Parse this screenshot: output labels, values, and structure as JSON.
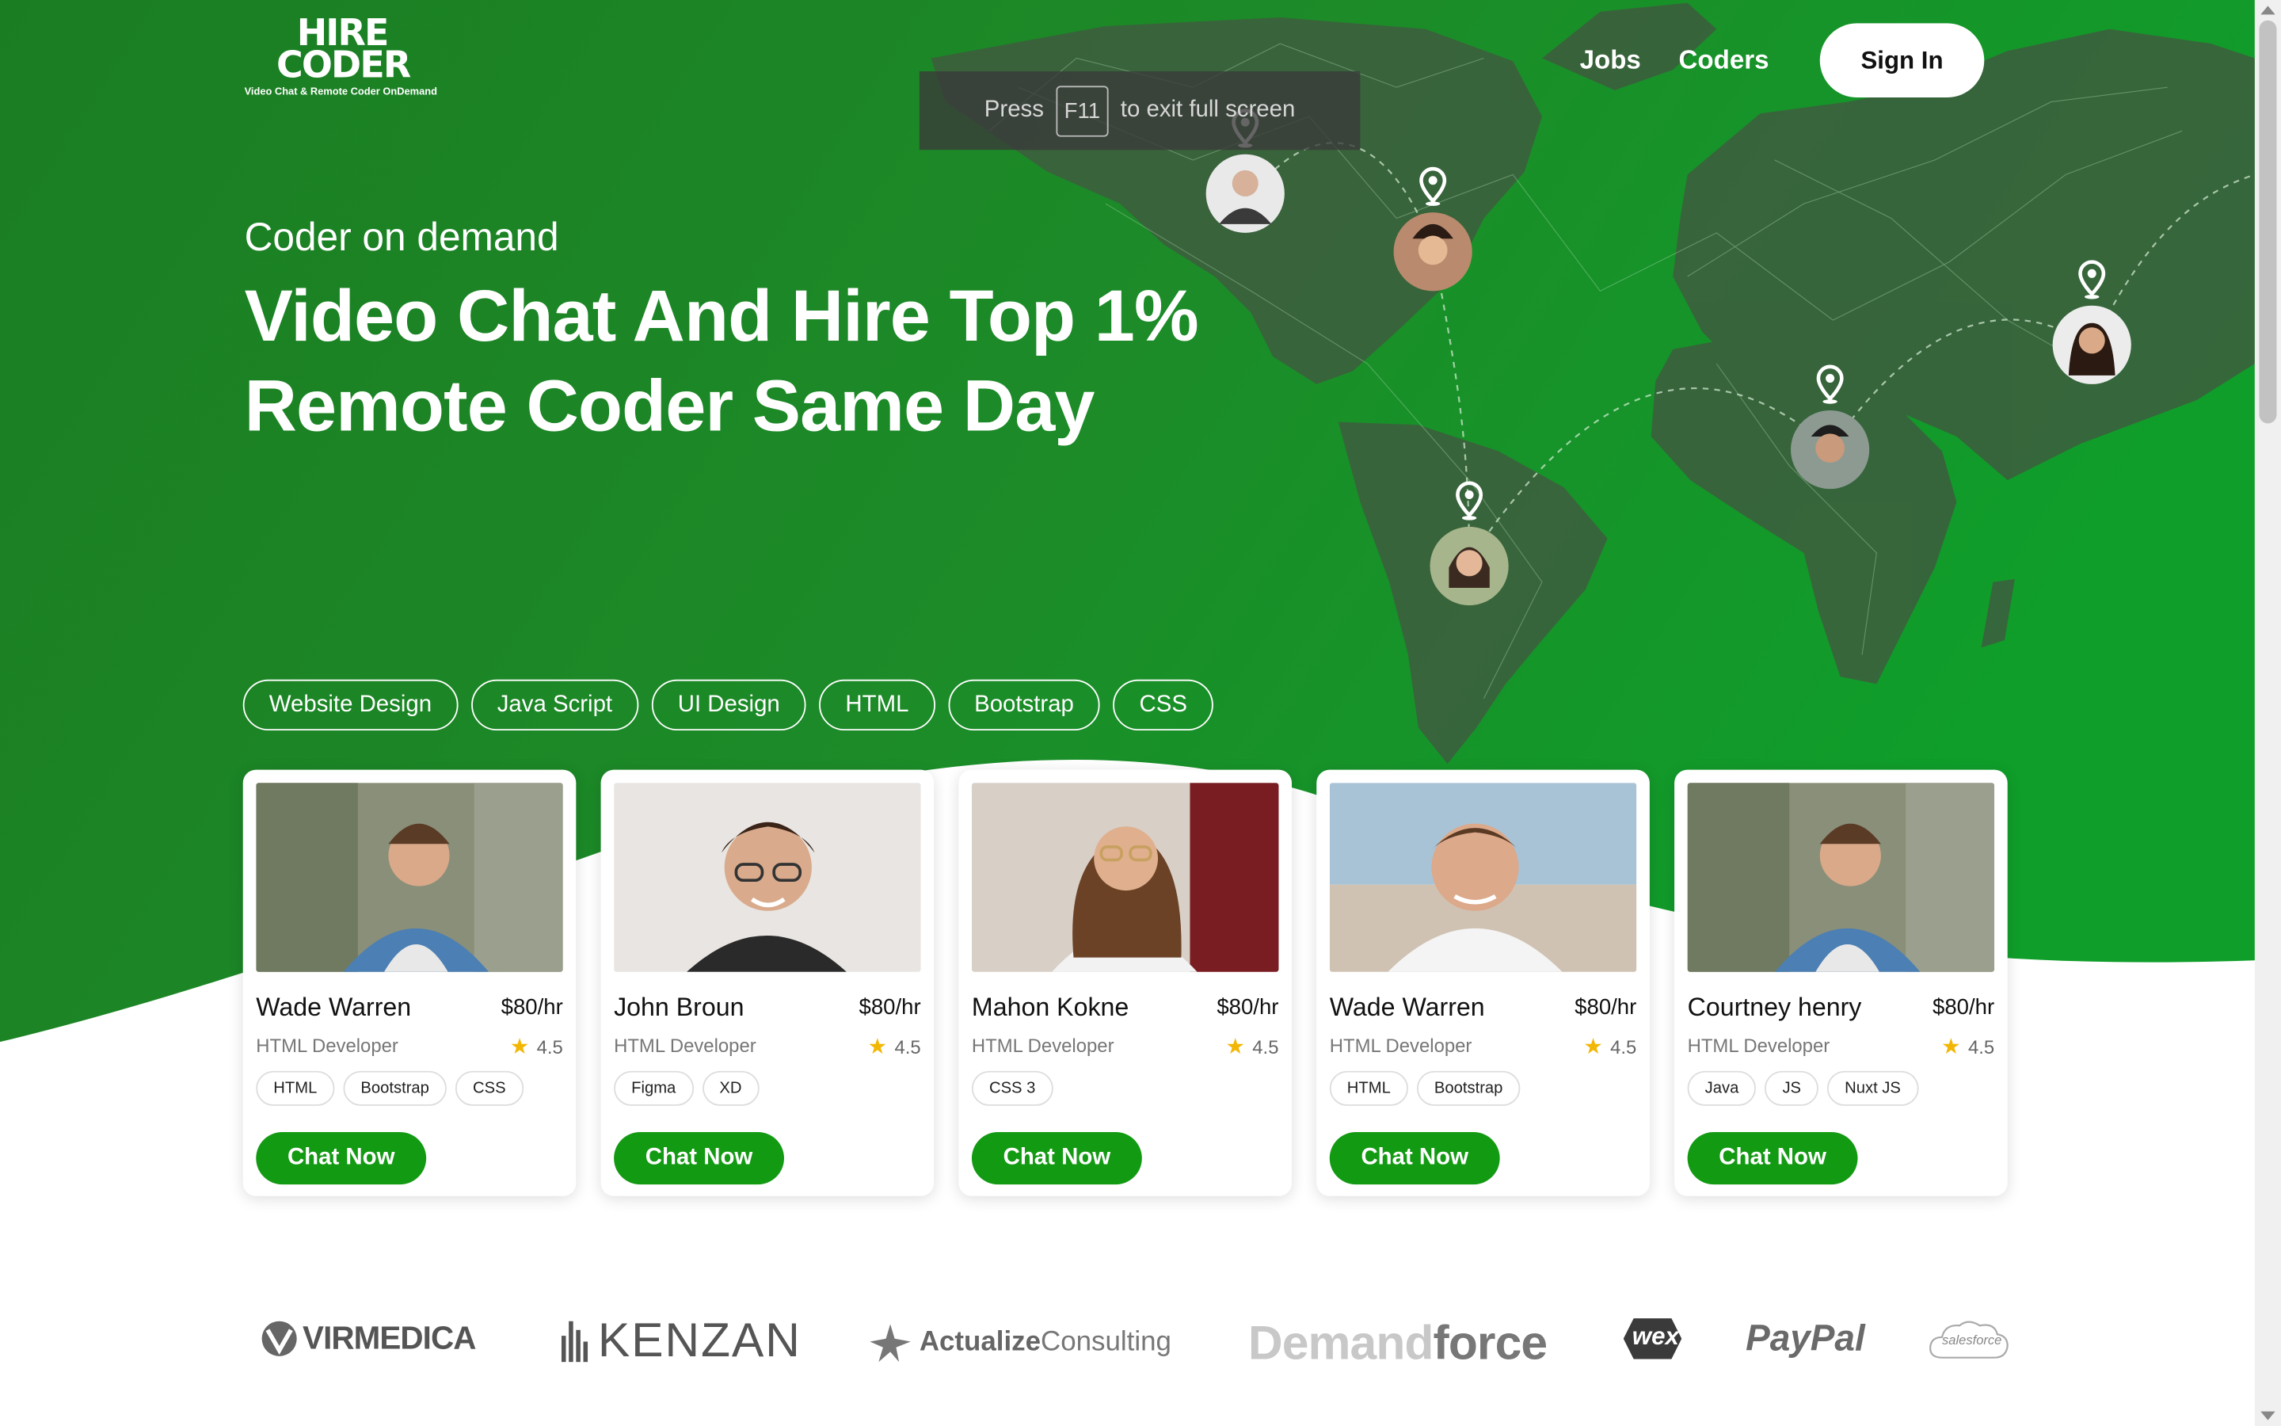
{
  "brand": {
    "logo_line1": "HIRE",
    "logo_line2": "CODER",
    "tagline": "Video Chat & Remote Coder OnDemand"
  },
  "nav": {
    "jobs": "Jobs",
    "coders": "Coders",
    "signin": "Sign In"
  },
  "fullscreen_hint": {
    "press": "Press",
    "key": "F11",
    "rest": "to exit full screen"
  },
  "hero": {
    "kicker": "Coder on demand",
    "headline_line1": "Video Chat And Hire Top 1%",
    "headline_line2": "Remote Coder Same Day"
  },
  "tags": [
    "Website Design",
    "Java Script",
    "UI Design",
    "HTML",
    "Bootstrap",
    "CSS"
  ],
  "coders": [
    {
      "name": "Wade Warren",
      "rate": "$80/hr",
      "role": "HTML Developer",
      "rating": "4.5",
      "skills": [
        "HTML",
        "Bootstrap",
        "CSS"
      ],
      "cta": "Chat Now"
    },
    {
      "name": "John Broun",
      "rate": "$80/hr",
      "role": "HTML Developer",
      "rating": "4.5",
      "skills": [
        "Figma",
        "XD"
      ],
      "cta": "Chat Now"
    },
    {
      "name": "Mahon Kokne",
      "rate": "$80/hr",
      "role": "HTML Developer",
      "rating": "4.5",
      "skills": [
        "CSS 3"
      ],
      "cta": "Chat Now"
    },
    {
      "name": "Wade Warren",
      "rate": "$80/hr",
      "role": "HTML Developer",
      "rating": "4.5",
      "skills": [
        "HTML",
        "Bootstrap"
      ],
      "cta": "Chat Now"
    },
    {
      "name": "Courtney henry",
      "rate": "$80/hr",
      "role": "HTML Developer",
      "rating": "4.5",
      "skills": [
        "Java",
        "JS",
        "Nuxt JS"
      ],
      "cta": "Chat Now"
    }
  ],
  "partners": {
    "virmedica": "VIRMEDICA",
    "kenzan": "KENZAN",
    "actualize_a": "Actualize",
    "actualize_b": "Consulting",
    "demand_a": "Demand",
    "demand_b": "force",
    "wex": "wex",
    "paypal": "PayPal",
    "salesforce": "salesforce"
  },
  "colors": {
    "hero_green": "#1f8a2a",
    "button_green": "#139a13",
    "star": "#f2b705"
  },
  "icons": [
    "location-pin-icon",
    "star-icon"
  ]
}
